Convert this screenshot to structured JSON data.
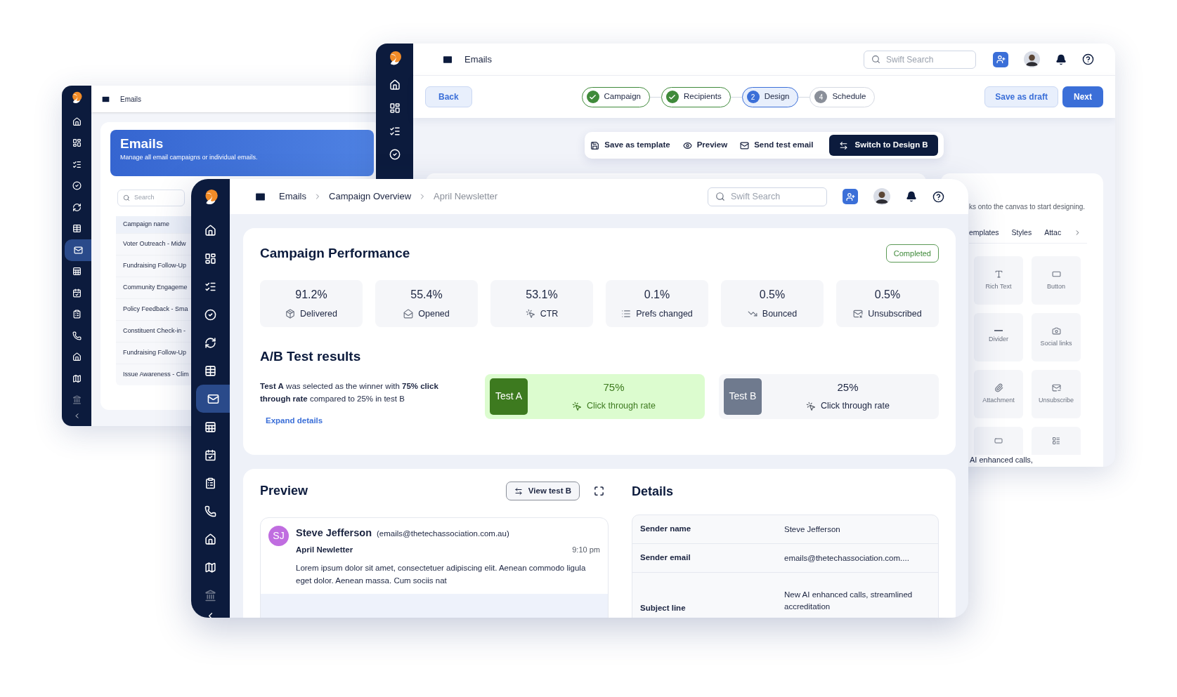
{
  "back_window": {
    "sidebar": [
      {
        "selected": false
      },
      {
        "selected": false
      },
      {
        "selected": false
      },
      {
        "selected": false
      },
      {
        "selected": false
      },
      {
        "selected": false
      },
      {
        "selected": true
      },
      {
        "selected": false
      },
      {
        "selected": false
      },
      {
        "selected": false
      },
      {
        "selected": false
      },
      {
        "selected": false
      },
      {
        "selected": false
      },
      {
        "selected": false
      }
    ],
    "header_title": "Emails",
    "banner": {
      "title": "Emails",
      "subtitle": "Manage all email campaigns or individual emails."
    },
    "search_placeholder": "Search",
    "list": {
      "header": "Campaign name",
      "rows": [
        "Voter Outreach - Midw",
        "Fundraising Follow-Up",
        "Community Engageme",
        "Policy Feedback - Sma",
        "Constituent Check-in -",
        "Fundraising Follow-Up",
        "Issue Awareness - Clim"
      ]
    }
  },
  "design_window": {
    "header_title": "Emails",
    "search_placeholder": "Swift Search",
    "back": "Back",
    "steps": [
      {
        "label": "Campaign",
        "completed": true,
        "selected": false
      },
      {
        "label": "Recipients",
        "completed": true,
        "selected": false
      },
      {
        "number": "2",
        "label": "Design",
        "completed": false,
        "selected": true
      },
      {
        "number": "4",
        "label": "Schedule",
        "completed": false,
        "selected": false
      }
    ],
    "save_draft": "Save as draft",
    "next": "Next",
    "toolbar": [
      "Save as template",
      "Preview",
      "Send test email"
    ],
    "switch_button": "Switch to Design B",
    "panel": {
      "hint": "ks onto the canvas to start designing.",
      "tabs": [
        "emplates",
        "Styles",
        "Attac"
      ],
      "tiles": [
        "Rich Text",
        "Button",
        "Divider",
        "Social links",
        "Attachment",
        "Unsubscribe"
      ],
      "overlay_text": "AI enhanced calls,"
    }
  },
  "main_window": {
    "sidebar": [
      {
        "selected": false
      },
      {
        "selected": false
      },
      {
        "selected": false
      },
      {
        "selected": false
      },
      {
        "selected": false
      },
      {
        "selected": false
      },
      {
        "selected": true
      },
      {
        "selected": false
      },
      {
        "selected": false
      },
      {
        "selected": false
      },
      {
        "selected": false
      },
      {
        "selected": false
      },
      {
        "selected": false
      },
      {
        "selected": false
      }
    ],
    "breadcrumbs": [
      {
        "label": "Emails",
        "current": false
      },
      {
        "label": "Campaign Overview",
        "current": false
      },
      {
        "label": "April Newsletter",
        "current": true
      }
    ],
    "search_placeholder": "Swift Search",
    "performance": {
      "title": "Campaign Performance",
      "status": "Completed",
      "stats": [
        {
          "value": "91.2%",
          "label": "Delivered"
        },
        {
          "value": "55.4%",
          "label": "Opened"
        },
        {
          "value": "53.1%",
          "label": "CTR"
        },
        {
          "value": "0.1%",
          "label": "Prefs changed"
        },
        {
          "value": "0.5%",
          "label": "Bounced"
        },
        {
          "value": "0.5%",
          "label": "Unsubscribed"
        }
      ]
    },
    "ab_test": {
      "title": "A/B Test results",
      "summary": "**Test A** was selected as the winner with **75% click through rate** compared to 25% in test B",
      "expand": "Expand details",
      "tests": [
        {
          "label": "Test A",
          "value": "75%",
          "metric": "Click through rate",
          "winner": true
        },
        {
          "label": "Test B",
          "value": "25%",
          "metric": "Click through rate",
          "winner": false
        }
      ]
    },
    "preview": {
      "title": "Preview",
      "view_button": "View test B",
      "email": {
        "initials": "SJ",
        "sender": "Steve Jefferson",
        "address": "(emails@thetechassociation.com.au)",
        "subject": "April Newletter",
        "time": "9:10 pm",
        "body": "Lorem ipsum dolor sit amet, consectetuer adipiscing elit. Aenean commodo ligula eget dolor. Aenean massa. Cum sociis nat"
      }
    },
    "details": {
      "title": "Details",
      "rows": [
        {
          "label": "Sender name",
          "value": "Steve Jefferson"
        },
        {
          "label": "Sender email",
          "value": "emails@thetechassociation.com...."
        },
        {
          "label": "Subject line",
          "value": "New AI enhanced calls, streamlined accreditation"
        }
      ]
    }
  }
}
